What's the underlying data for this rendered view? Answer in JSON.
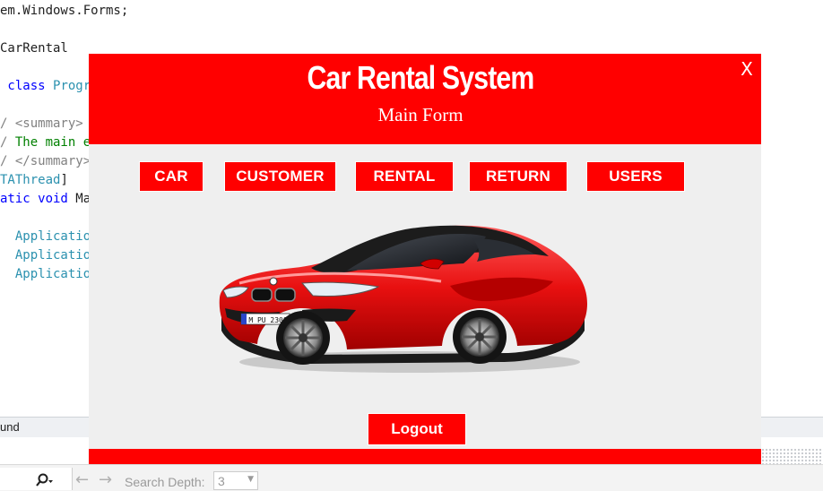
{
  "editor": {
    "lines": [
      {
        "segments": [
          {
            "text": "em.Windows.Forms;",
            "cls": ""
          }
        ]
      },
      {
        "segments": [
          {
            "text": "CarRental",
            "cls": ""
          }
        ]
      },
      {
        "segments": [
          {
            "text": " class ",
            "cls": "kw"
          },
          {
            "text": "Progr",
            "cls": "ty"
          }
        ]
      },
      {
        "segments": [
          {
            "text": "/ <summary>",
            "cls": "cm"
          }
        ]
      },
      {
        "segments": [
          {
            "text": "/ ",
            "cls": "cm"
          },
          {
            "text": "The main e",
            "cls": "cg"
          }
        ]
      },
      {
        "segments": [
          {
            "text": "/ </summary>",
            "cls": "cm"
          }
        ]
      },
      {
        "segments": [
          {
            "text": "TAThread",
            "cls": "ty"
          },
          {
            "text": "]",
            "cls": ""
          }
        ]
      },
      {
        "segments": [
          {
            "text": "atic void ",
            "cls": "kw"
          },
          {
            "text": "Ma",
            "cls": ""
          }
        ]
      },
      {
        "segments": [
          {
            "text": "  Applicatio",
            "cls": "ty"
          }
        ]
      },
      {
        "segments": [
          {
            "text": "  Applicatio",
            "cls": "ty"
          }
        ]
      },
      {
        "segments": [
          {
            "text": "  Applicatio",
            "cls": "ty"
          }
        ]
      }
    ]
  },
  "ide": {
    "panel_label": "und",
    "search_depth_label": "Search Depth:",
    "search_depth_value": "3"
  },
  "form": {
    "title": "Car Rental System",
    "subtitle": "Main Form",
    "close_label": "X",
    "nav_buttons": [
      {
        "label": "CAR"
      },
      {
        "label": "CUSTOMER"
      },
      {
        "label": "RENTAL"
      },
      {
        "label": "RETURN"
      },
      {
        "label": "USERS"
      }
    ],
    "car_image": {
      "plate": "M PU 2308"
    },
    "logout_label": "Logout"
  },
  "colors": {
    "accent": "#ff0000",
    "form_background": "#efefef",
    "text_on_accent": "#ffffff"
  }
}
